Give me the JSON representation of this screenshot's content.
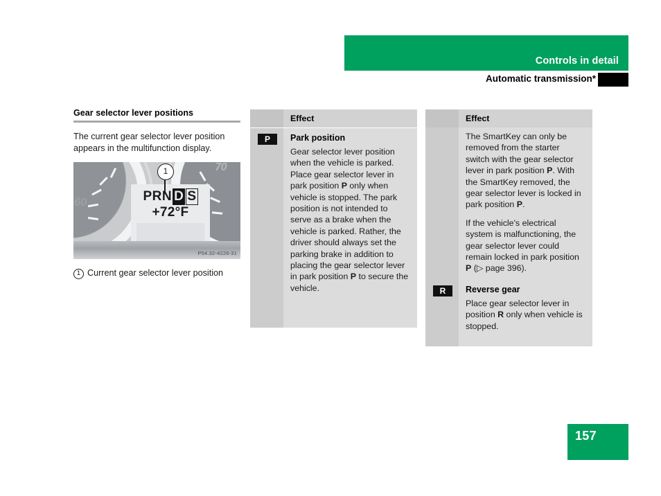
{
  "header": {
    "chapter_title": "Controls in detail",
    "section_title": "Automatic transmission*",
    "green": "#00a05e"
  },
  "left_column": {
    "heading": "Gear selector lever positions",
    "intro": "The current gear selector lever position appears in the multifunction display.",
    "figure": {
      "image_id": "P54.32-4226-31",
      "callout_number": "1",
      "gauge_label_left": "60",
      "gauge_label_right": "70",
      "display_gears_prefix": "PRN",
      "display_gear_active": "D",
      "display_gear_boxed": "S",
      "display_temperature": "+72°F"
    },
    "caption_marker": "1",
    "caption_text": "Current gear selector lever position"
  },
  "tables": [
    {
      "id": "middle",
      "header_label": "Effect",
      "rows": [
        {
          "badge": "P",
          "title": "Park position",
          "paragraphs": [
            "Gear selector lever position when the vehicle is parked. Place gear selector lever in park position <b>P</b> only when vehicle is stopped. The park position is not intended to serve as a brake when the vehicle is parked. Rather, the driver should always set the parking brake in addition to placing the gear selector lever in park position <b>P</b> to secure the vehicle."
          ]
        }
      ]
    },
    {
      "id": "right",
      "header_label": "Effect",
      "rows": [
        {
          "badge": "",
          "title": "",
          "paragraphs": [
            "The SmartKey can only be removed from the starter switch with the gear selector lever in park position <b>P</b>. With the SmartKey removed, the gear selector lever is locked in park position <b>P</b>.",
            "If the vehicle's electrical system is malfunctioning, the gear selector lever could remain locked in park position <b>P</b> (▷ page 396)."
          ]
        },
        {
          "badge": "R",
          "title": "Reverse gear",
          "paragraphs": [
            "Place gear selector lever in position <b>R</b> only when vehicle is stopped."
          ]
        }
      ]
    }
  ],
  "footer": {
    "page_number": "157"
  }
}
